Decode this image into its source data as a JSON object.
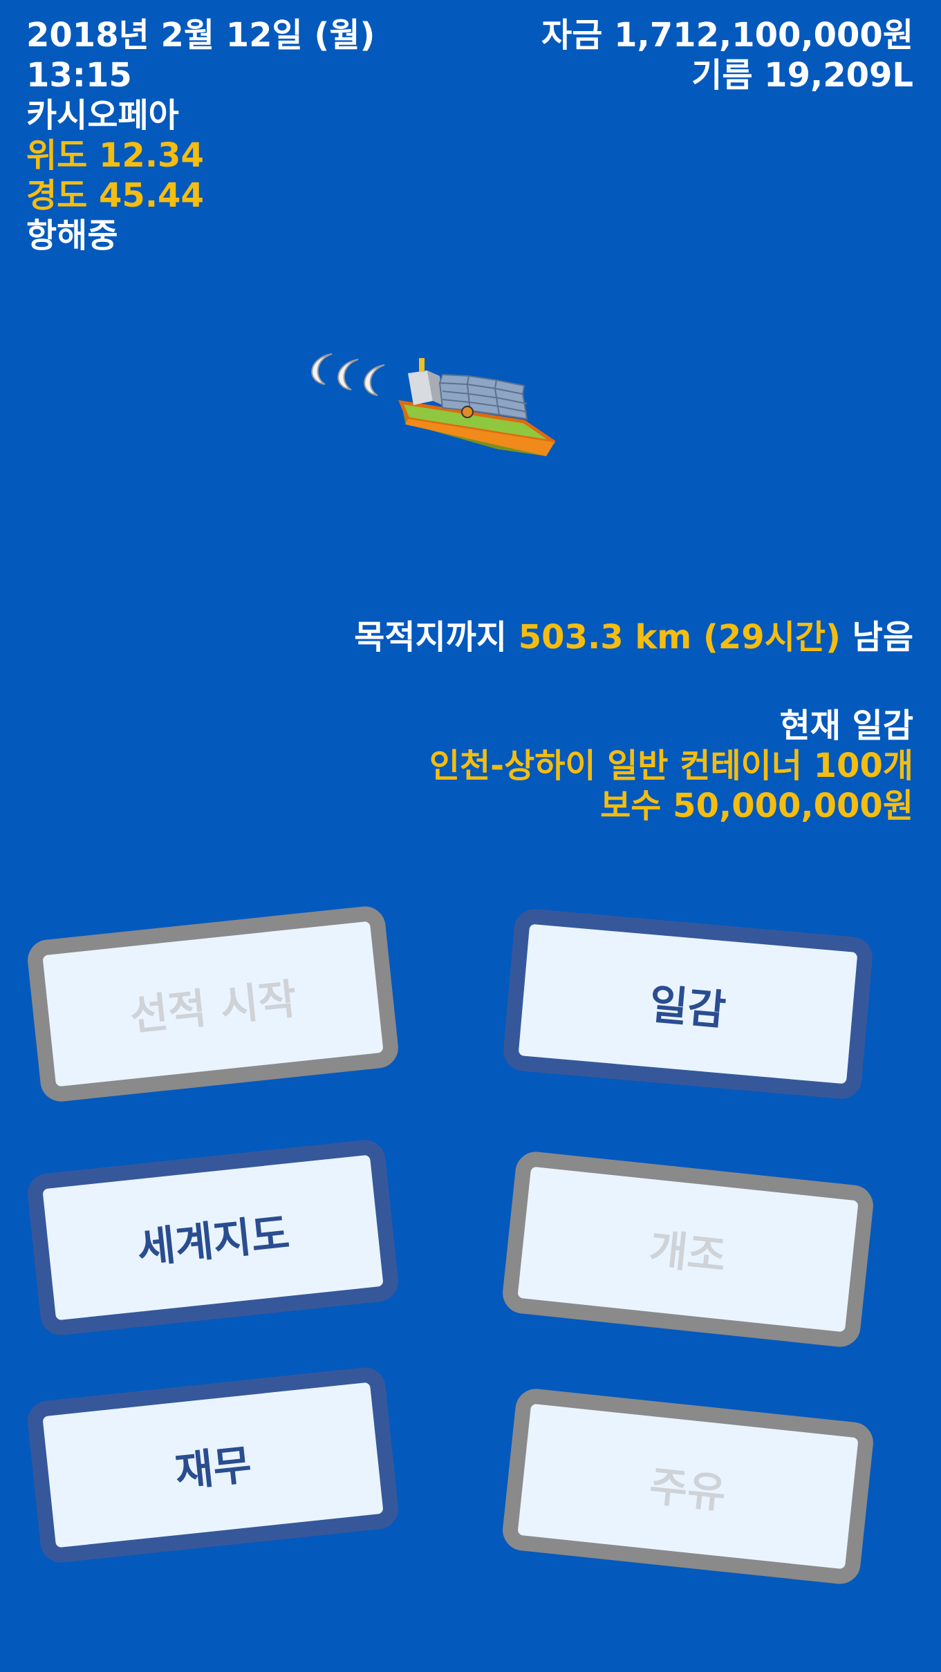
{
  "status": {
    "date": "2018년 2월 12일 (월)",
    "time": "13:15",
    "ship_name": "카시오페아",
    "latitude": "위도 12.34",
    "longitude": "경도 45.44",
    "state": "항해중",
    "funds": "자금 1,712,100,000원",
    "fuel": "기름 19,209L"
  },
  "voyage": {
    "remain_prefix": "목적지까지 ",
    "remain_value": "503.3 km (29시간)",
    "remain_suffix": " 남음"
  },
  "contract": {
    "title": "현재 일감",
    "route": "인천-상하이 일반 컨테이너 100개",
    "reward": "보수 50,000,000원"
  },
  "menu": {
    "load_start": "선적 시작",
    "jobs": "일감",
    "world_map": "세계지도",
    "refit": "개조",
    "finance": "재무",
    "refuel": "주유"
  },
  "colors": {
    "background": "#0459bd",
    "highlight": "#f5bd0f",
    "enabled_border": "#36589a",
    "disabled_border": "#8a8a8a"
  }
}
